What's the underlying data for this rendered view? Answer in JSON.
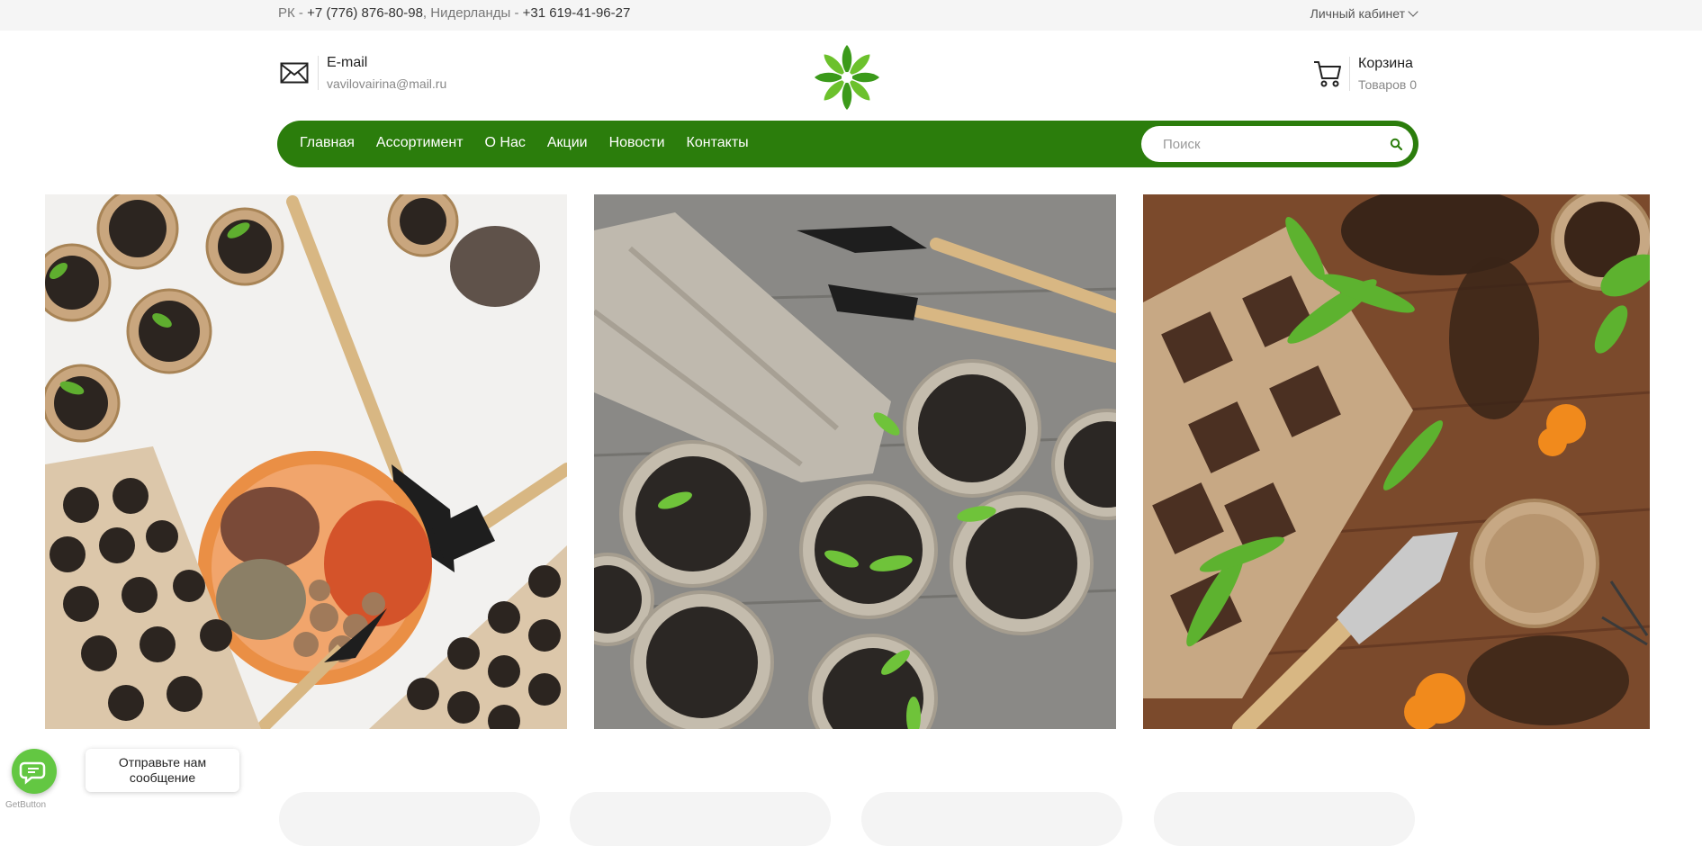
{
  "topbar": {
    "phone_prefix_1": "РК - ",
    "phone_1": "+7 (776) 876-80-98",
    "phone_sep": ", Нидерланды - ",
    "phone_2": "+31 619-41-96-27",
    "account_label": "Личный кабинет"
  },
  "header": {
    "email_title": "E-mail",
    "email_address": "vavilovairina@mail.ru",
    "cart_title": "Корзина",
    "cart_count": "Товаров 0"
  },
  "nav": {
    "items": [
      {
        "label": "Главная"
      },
      {
        "label": "Ассортимент"
      },
      {
        "label": "О Нас"
      },
      {
        "label": "Акции"
      },
      {
        "label": "Новости"
      },
      {
        "label": "Контакты"
      }
    ]
  },
  "search": {
    "placeholder": "Поиск",
    "value": ""
  },
  "chat": {
    "bubble_text": "Отправьте нам сообщение",
    "powered": "GetButton"
  },
  "colors": {
    "brand_green": "#2b7d0c",
    "chat_green": "#63c742"
  },
  "icons": [
    "mail-icon",
    "cart-icon",
    "search-icon",
    "chat-icon",
    "logo-flower-icon",
    "chevron-down-icon"
  ]
}
